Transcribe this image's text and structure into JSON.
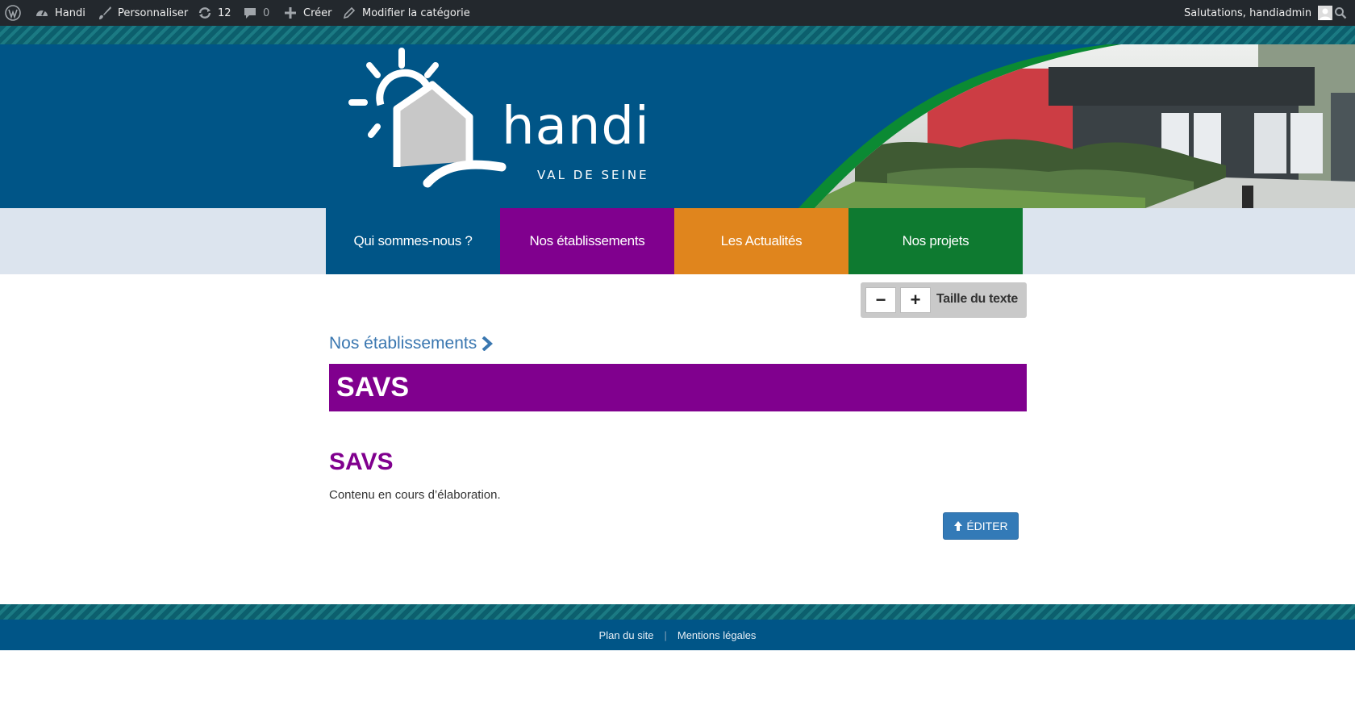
{
  "admin_bar": {
    "items": [
      {
        "icon": "wordpress-logo-icon"
      },
      {
        "icon": "dashboard-gauge-icon",
        "label": "Handi"
      },
      {
        "icon": "paintbrush-icon",
        "label": "Personnaliser"
      },
      {
        "icon": "updates-icon",
        "label": "12"
      },
      {
        "icon": "comment-bubble-icon",
        "label": "0"
      },
      {
        "icon": "plus-icon",
        "label": "Créer"
      },
      {
        "icon": "pencil-icon",
        "label": "Modifier la catégorie"
      }
    ],
    "greeting": "Salutations, handiadmin",
    "search_icon": "search-icon"
  },
  "header": {
    "logo_word": "handi",
    "logo_tagline": "VAL DE SEINE"
  },
  "nav": {
    "items": [
      {
        "label": "Qui sommes-nous ?",
        "color": "#005587"
      },
      {
        "label": "Nos établissements",
        "color": "#80008e"
      },
      {
        "label": "Les Actualités",
        "color": "#e0851d"
      },
      {
        "label": "Nos projets",
        "color": "#0e7a30"
      }
    ]
  },
  "text_size": {
    "minus": "−",
    "plus": "+",
    "label": "Taille du texte"
  },
  "breadcrumb": {
    "label": "Nos établissements"
  },
  "page": {
    "title": "SAVS",
    "subtitle": "SAVS",
    "content": "Contenu en cours d’élaboration.",
    "edit_label": "ÉDITER"
  },
  "footer": {
    "links": [
      "Plan du site",
      "Mentions légales"
    ]
  },
  "colors": {
    "primary_blue": "#005587",
    "purple": "#80008e",
    "orange": "#e0851d",
    "green": "#0e7a30",
    "edit_button": "#337ab7"
  }
}
